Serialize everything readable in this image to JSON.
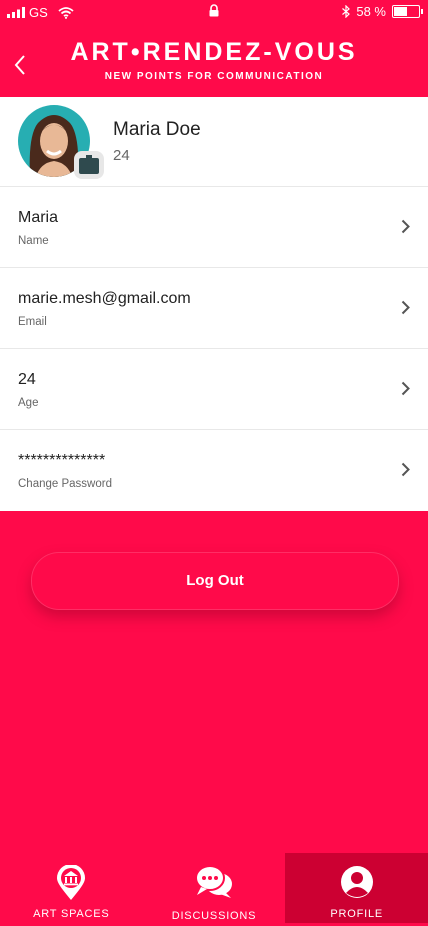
{
  "status_bar": {
    "carrier": "GS",
    "battery_percent": "58 %",
    "battery_level": 0.58,
    "icons": [
      "signal-icon",
      "wifi-icon",
      "lock-icon",
      "bluetooth-icon",
      "battery-icon"
    ]
  },
  "header": {
    "title": "ART•RENDEZ-VOUS",
    "subtitle": "NEW POINTS FOR COMMUNICATION",
    "back_icon": "chevron-left-icon"
  },
  "profile": {
    "name": "Maria Doe",
    "age": "24",
    "camera_icon": "camera-icon"
  },
  "fields": [
    {
      "value": "Maria",
      "label": "Name"
    },
    {
      "value": "marie.mesh@gmail.com",
      "label": "Email"
    },
    {
      "value": "24",
      "label": "Age"
    },
    {
      "value": "**************",
      "label": "Change Password"
    }
  ],
  "logout_label": "Log Out",
  "tabs": [
    {
      "label": "ART SPACES",
      "icon": "map-pin-museum-icon",
      "active": false
    },
    {
      "label": "DISCUSSIONS",
      "icon": "chat-bubbles-icon",
      "active": false
    },
    {
      "label": "PROFILE",
      "icon": "user-icon",
      "active": true
    }
  ],
  "colors": {
    "accent": "#ff0a4a",
    "active_tab": "#cc0032",
    "card_bg": "#ffffff"
  }
}
